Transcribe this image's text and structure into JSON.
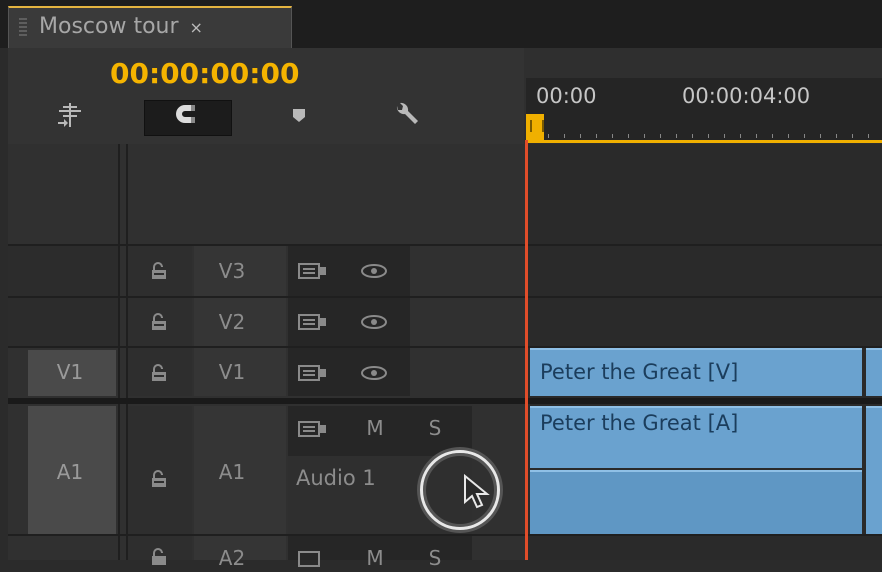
{
  "tab": {
    "title": "Moscow tour",
    "close": "×"
  },
  "timecode": "00:00:00:00",
  "ruler": {
    "labels": [
      "00:00",
      "00:00:04:00"
    ]
  },
  "tracks": {
    "v3": {
      "name": "V3"
    },
    "v2": {
      "name": "V2"
    },
    "v1": {
      "source": "V1",
      "name": "V1"
    },
    "a1": {
      "source": "A1",
      "name": "A1",
      "mute": "M",
      "solo": "S",
      "label": "Audio 1"
    },
    "a2": {
      "name": "A2",
      "mute": "M",
      "solo": "S"
    }
  },
  "clips": {
    "video": "Peter the Great [V]",
    "audio": "Peter the Great [A]"
  },
  "colors": {
    "accent": "#f5b400",
    "playhead": "#e04d2a",
    "clip": "#6aa2cf"
  }
}
